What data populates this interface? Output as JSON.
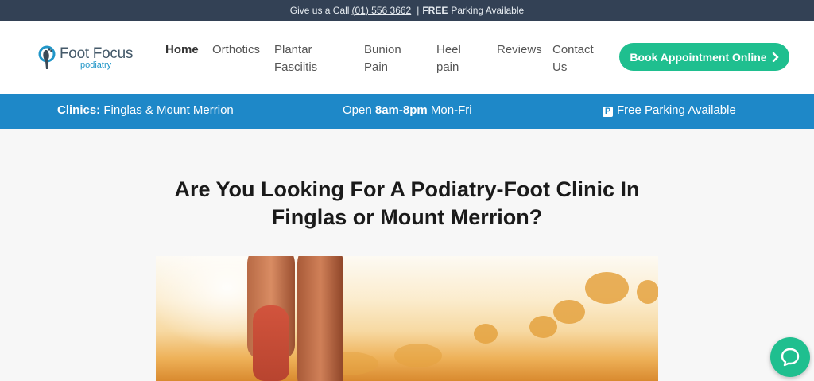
{
  "topbar": {
    "call_prefix": "Give us a Call",
    "phone": "(01) 556 3662",
    "separator": "|",
    "free_word": "FREE",
    "parking_text": "Parking Available"
  },
  "logo": {
    "name": "Foot Focus",
    "tagline": "podiatry"
  },
  "nav": {
    "items": [
      {
        "line1": "Home",
        "line2": ""
      },
      {
        "line1": "Orthotics",
        "line2": ""
      },
      {
        "line1": "Plantar",
        "line2": "Fasciitis"
      },
      {
        "line1": "Bunion",
        "line2": "Pain"
      },
      {
        "line1": "Heel",
        "line2": "pain"
      },
      {
        "line1": "Reviews",
        "line2": ""
      },
      {
        "line1": "Contact",
        "line2": "Us"
      }
    ],
    "active": "Home",
    "cta_label": "Book Appointment Online",
    "cta_icon": "chevron-right-icon"
  },
  "infobar": {
    "clinics_label": "Clinics:",
    "clinics_value": "Finglas & Mount Merrion",
    "hours_prefix": "Open",
    "hours": "8am-8pm",
    "hours_suffix": "Mon-Fri",
    "parking_icon_glyph": "P",
    "parking_text": "Free Parking Available"
  },
  "main": {
    "headline_line1": "Are You Looking For A Podiatry-Foot Clinic In",
    "headline_line2": "Finglas or Mount Merrion?"
  },
  "chat": {
    "icon": "chat-bubble-icon"
  },
  "colors": {
    "topbar_bg": "#334155",
    "infobar_bg": "#1e88c8",
    "accent_green": "#1fbf8f",
    "logo_blue": "#2196c8"
  }
}
